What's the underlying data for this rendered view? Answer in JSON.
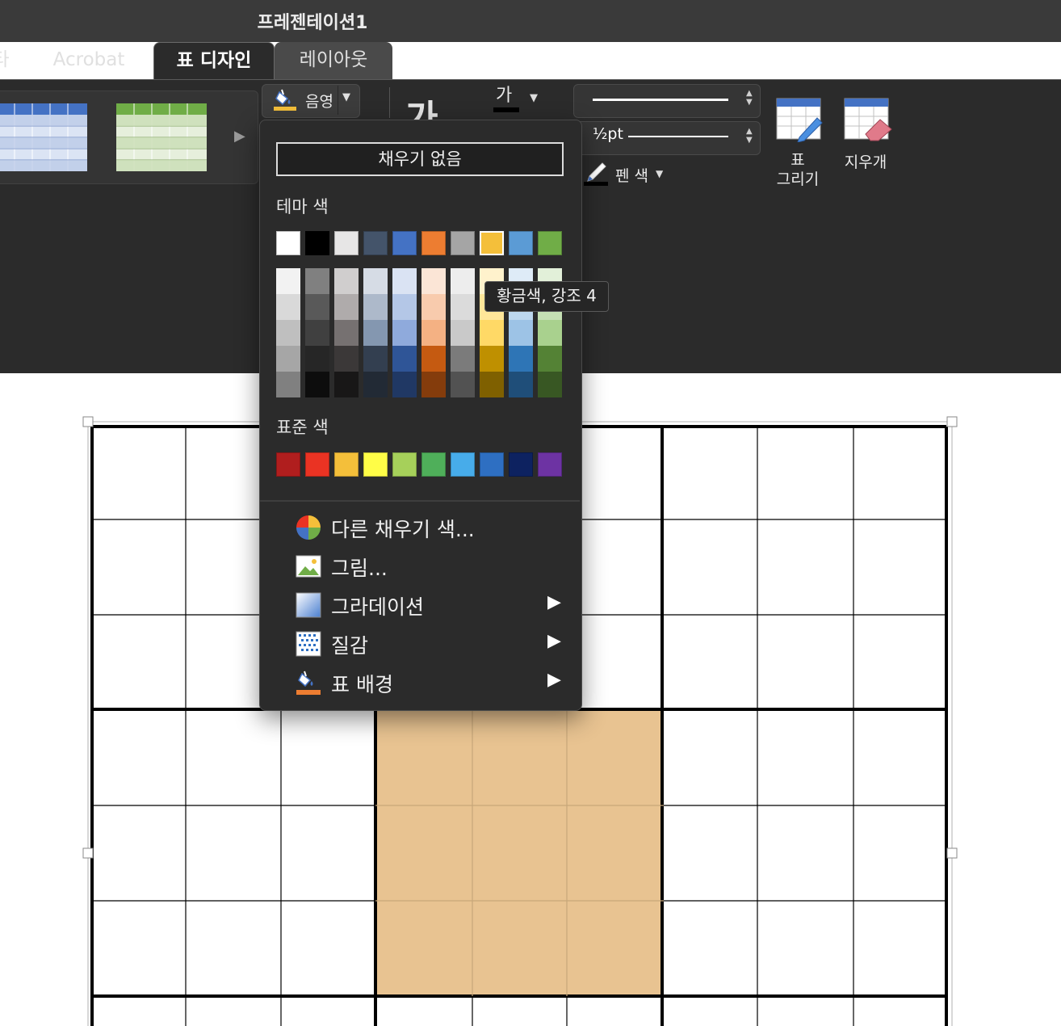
{
  "window": {
    "title": "프레젠테이션1"
  },
  "tabs": [
    {
      "label": "타",
      "state": "partial"
    },
    {
      "label": "Acrobat",
      "state": "normal"
    },
    {
      "label": "표 디자인",
      "state": "active"
    },
    {
      "label": "레이아웃",
      "state": "normal"
    }
  ],
  "ribbon": {
    "shading": {
      "label": "음영",
      "icon": "paint-bucket-icon"
    },
    "wordart": {
      "glyph": "가",
      "font_color_glyph": "가"
    },
    "border": {
      "weight_label": "½pt"
    },
    "pen_color": {
      "label": "펜 색",
      "icon": "pen-color-icon"
    },
    "draw_table": {
      "label_line1": "표",
      "label_line2": "그리기",
      "icon": "draw-table-icon"
    },
    "eraser": {
      "label": "지우개",
      "icon": "eraser-icon"
    }
  },
  "shading_menu": {
    "no_fill": "채우기 없음",
    "theme_colors_label": "테마 색",
    "standard_colors_label": "표준 색",
    "theme_colors": [
      "#ffffff",
      "#000000",
      "#e7e6e6",
      "#44546a",
      "#4472c4",
      "#ed7d31",
      "#a5a5a5",
      "#f4bf3a",
      "#5b9bd5",
      "#70ad47"
    ],
    "selected_theme_index": 7,
    "theme_shades": [
      [
        "#f2f2f2",
        "#d9d9d9",
        "#bfbfbf",
        "#a6a6a6",
        "#808080"
      ],
      [
        "#808080",
        "#595959",
        "#404040",
        "#262626",
        "#0d0d0d"
      ],
      [
        "#d0cece",
        "#afabab",
        "#767171",
        "#3b3838",
        "#181717"
      ],
      [
        "#d6dce5",
        "#adb9ca",
        "#8497b0",
        "#333f50",
        "#222a35"
      ],
      [
        "#dae3f3",
        "#b4c7e7",
        "#8faadc",
        "#2f5597",
        "#203864"
      ],
      [
        "#fbe5d6",
        "#f8cbad",
        "#f4b183",
        "#c55a11",
        "#843c0c"
      ],
      [
        "#ededed",
        "#dbdbdb",
        "#c9c9c9",
        "#7b7b7b",
        "#525252"
      ],
      [
        "#fff2cc",
        "#ffe699",
        "#ffd966",
        "#bf9000",
        "#7f6000"
      ],
      [
        "#deebf7",
        "#bdd7ee",
        "#9dc3e6",
        "#2e75b6",
        "#1f4e79"
      ],
      [
        "#e2f0d9",
        "#c5e0b4",
        "#a9d18e",
        "#548235",
        "#385723"
      ]
    ],
    "standard_colors": [
      "#b01e1e",
      "#ea3323",
      "#f4bf3a",
      "#fffd47",
      "#a6d05a",
      "#4faf5a",
      "#47acea",
      "#2e6fc2",
      "#0d2260",
      "#6d33a3"
    ],
    "items": [
      {
        "label": "다른 채우기 색...",
        "icon": "color-wheel-icon",
        "submenu": false
      },
      {
        "label": "그림...",
        "icon": "picture-icon",
        "submenu": false
      },
      {
        "label": "그라데이션",
        "icon": "gradient-icon",
        "submenu": true
      },
      {
        "label": "질감",
        "icon": "texture-icon",
        "submenu": true
      },
      {
        "label": "표 배경",
        "icon": "table-background-icon",
        "submenu": true
      }
    ],
    "submenu_arrow": "▶"
  },
  "tooltip": "황금색, 강조 4",
  "slide_table": {
    "highlight_color": "#e8c391"
  }
}
